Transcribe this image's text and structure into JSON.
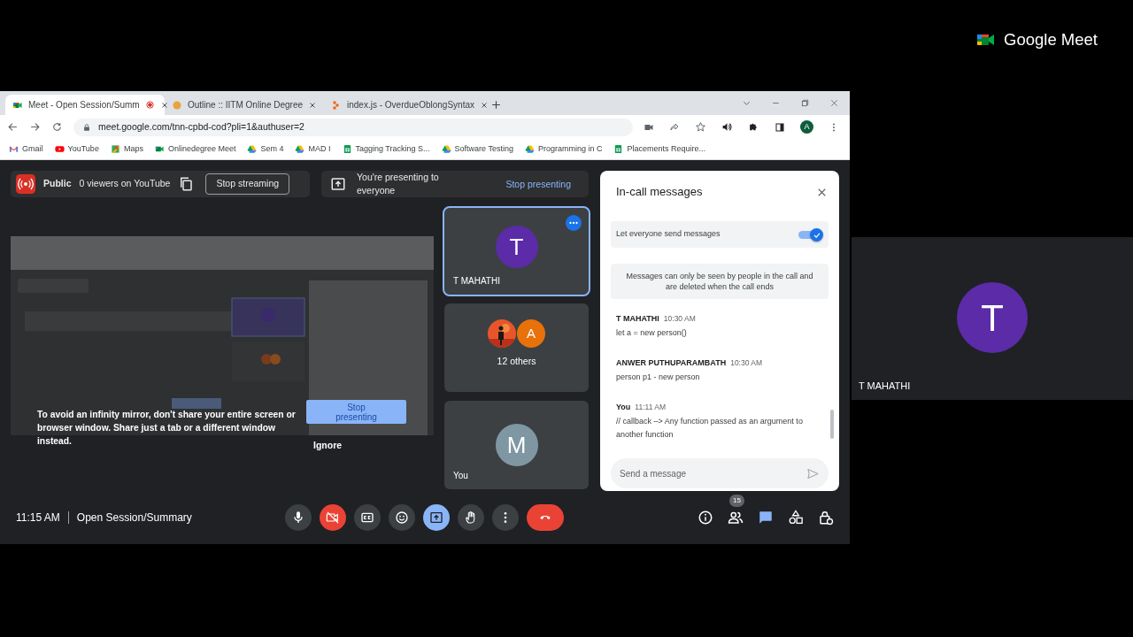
{
  "browser": {
    "tabs": [
      {
        "title": "Meet - Open Session/Summ",
        "kind": "meet",
        "selected": true,
        "recording": true
      },
      {
        "title": "Outline :: IITM Online Degree",
        "kind": "dot",
        "selected": false,
        "recording": false
      },
      {
        "title": "index.js - OverdueOblongSyntax",
        "kind": "blocks",
        "selected": false,
        "recording": false
      }
    ],
    "url": "meet.google.com/tnn-cpbd-cod?pli=1&authuser=2",
    "profile_initial": "A",
    "bookmarks": [
      {
        "label": "Gmail",
        "kind": "mail"
      },
      {
        "label": "YouTube",
        "kind": "play"
      },
      {
        "label": "Maps",
        "kind": "pin"
      },
      {
        "label": "Onlinedegree Meet",
        "kind": "video"
      },
      {
        "label": "Sem 4",
        "kind": "triangle"
      },
      {
        "label": "MAD I",
        "kind": "triangle"
      },
      {
        "label": "Tagging Tracking S...",
        "kind": "sheet"
      },
      {
        "label": "Software Testing",
        "kind": "triangle"
      },
      {
        "label": "Programming in C",
        "kind": "triangle"
      },
      {
        "label": "Placements Require...",
        "kind": "sheet"
      }
    ]
  },
  "stream_bar": {
    "visibility": "Public",
    "viewers": "0 viewers on YouTube",
    "stop_button": "Stop streaming"
  },
  "present_bar": {
    "message": "You're presenting to everyone",
    "stop_button": "Stop presenting"
  },
  "stage": {
    "warning": "To avoid an infinity mirror, don't share your entire screen or browser window. Share just a tab or a different window instead.",
    "stop_button": "Stop presenting",
    "ignore_button": "Ignore"
  },
  "tiles": [
    {
      "kind": "person",
      "name": "T MAHATHI",
      "initial": "T",
      "color": "#5b2ba8",
      "selected": true
    },
    {
      "kind": "group",
      "label": "12 others",
      "avatars": [
        {
          "kind": "picture"
        },
        {
          "kind": "initial",
          "initial": "A",
          "color": "#e8710a"
        }
      ],
      "selected": false
    },
    {
      "kind": "person",
      "name": "You",
      "initial": "M",
      "color": "#7f97a3",
      "selected": false
    }
  ],
  "chat": {
    "title": "In-call messages",
    "toggle_label": "Let everyone send messages",
    "toggle_on": true,
    "notice": "Messages can only be seen by people in the call and are deleted when the call ends",
    "messages": [
      {
        "sender": "T MAHATHI",
        "time": "10:30 AM",
        "text": "let a = new person()"
      },
      {
        "sender": "ANWER PUTHUPARAMBATH",
        "time": "10:30 AM",
        "text": "person p1 - new person"
      },
      {
        "sender": "You",
        "time": "11:11 AM",
        "text": "// callback –> Any function passed as an argument to another function"
      }
    ],
    "placeholder": "Send a message"
  },
  "call_bar": {
    "time": "11:15 AM",
    "meeting": "Open Session/Summary",
    "controls": [
      {
        "kind": "mic",
        "on": true
      },
      {
        "kind": "camera",
        "on": false
      },
      {
        "kind": "captions",
        "on": false
      },
      {
        "kind": "emoji"
      },
      {
        "kind": "present",
        "on": true
      },
      {
        "kind": "hand",
        "on": false
      },
      {
        "kind": "more"
      },
      {
        "kind": "leave"
      }
    ],
    "side_icons": [
      {
        "kind": "info",
        "selected": false
      },
      {
        "kind": "people",
        "count": "15",
        "selected": false
      },
      {
        "kind": "chat",
        "selected": true
      },
      {
        "kind": "activities",
        "selected": false
      },
      {
        "kind": "host",
        "selected": false
      }
    ]
  },
  "sidebar": {
    "logo": "Google Meet",
    "tile": {
      "name": "T MAHATHI",
      "initial": "T",
      "color": "#5b2ba8"
    }
  }
}
